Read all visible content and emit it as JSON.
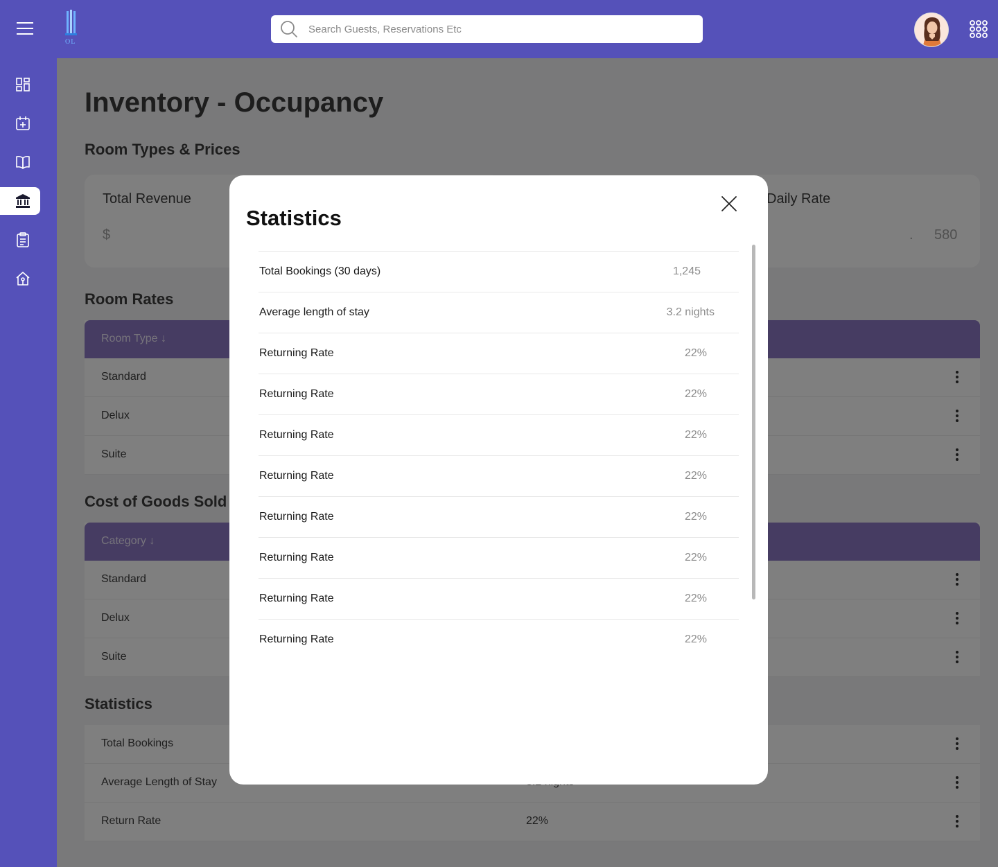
{
  "header": {
    "logo_text": "OL",
    "search_placeholder": "Search Guests, Reservations Etc",
    "menu_icon": "hamburger-menu-icon",
    "apps_icon": "apps-grid-icon"
  },
  "sidebar": {
    "items": [
      {
        "name": "dashboard-icon"
      },
      {
        "name": "calendar-add-icon"
      },
      {
        "name": "book-icon"
      },
      {
        "name": "bank-icon",
        "active": true
      },
      {
        "name": "clipboard-icon"
      },
      {
        "name": "home-icon"
      }
    ]
  },
  "page": {
    "title": "Inventory - Occupancy",
    "room_types_title": "Room Types & Prices",
    "kpi": {
      "total_revenue_label": "Total Revenue",
      "total_revenue_value": "$",
      "daily_rate_label": "Daily Rate",
      "daily_rate_dot": ".",
      "daily_rate_value": "580"
    },
    "room_rates": {
      "title": "Room Rates",
      "header": "Room Type ↓",
      "rows": [
        "Standard",
        "Delux",
        "Suite"
      ]
    },
    "cogs": {
      "title": "Cost of Goods Sold",
      "header": "Category ↓",
      "rows": [
        "Standard",
        "Delux",
        "Suite"
      ]
    },
    "statistics": {
      "title": "Statistics",
      "rows": [
        {
          "label": "Total Bookings",
          "value": ""
        },
        {
          "label": "Average Length of Stay",
          "value": "3.2 nights"
        },
        {
          "label": "Return Rate",
          "value": "22%"
        }
      ]
    }
  },
  "modal": {
    "title": "Statistics",
    "rows": [
      {
        "label": "Total Bookings (30 days)",
        "value": "1,245"
      },
      {
        "label": "Average length of stay",
        "value": "3.2 nights"
      },
      {
        "label": "Returning Rate",
        "value": "22%"
      },
      {
        "label": "Returning Rate",
        "value": "22%"
      },
      {
        "label": "Returning Rate",
        "value": "22%"
      },
      {
        "label": "Returning Rate",
        "value": "22%"
      },
      {
        "label": "Returning Rate",
        "value": "22%"
      },
      {
        "label": "Returning Rate",
        "value": "22%"
      },
      {
        "label": "Returning Rate",
        "value": "22%"
      },
      {
        "label": "Returning Rate",
        "value": "22%"
      }
    ]
  },
  "colors": {
    "brand": "#5551b9",
    "table_header": "#8d78c4"
  }
}
